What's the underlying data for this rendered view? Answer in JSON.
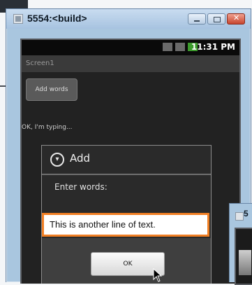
{
  "window": {
    "title": "5554:<build>",
    "controls": [
      "minimize",
      "maximize",
      "close"
    ]
  },
  "phone": {
    "status": {
      "time": "11:31 PM",
      "icons": [
        "signal-icon",
        "network-icon",
        "battery-icon"
      ]
    },
    "screen_title": "Screen1",
    "add_button_label": "Add words",
    "typing_text": "OK, I'm typing...",
    "dialog": {
      "title": "Add",
      "label": "Enter words:",
      "input_value": "This is another line of text.",
      "ok_label": "OK"
    }
  },
  "secondary_window": {
    "title_fragment": "5"
  },
  "colors": {
    "accent_input_border": "#f07f24"
  }
}
